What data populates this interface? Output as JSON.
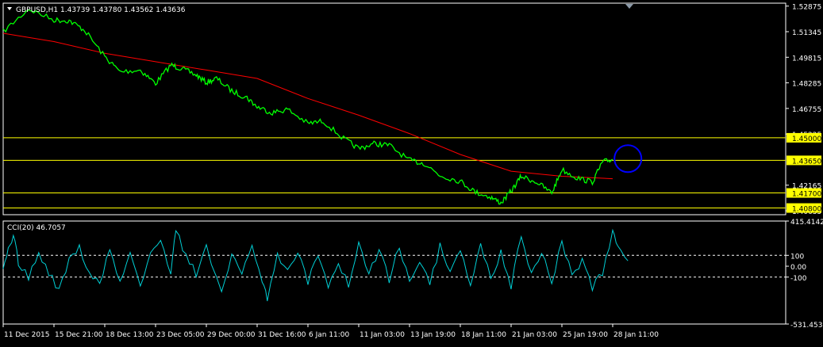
{
  "chart_data": [
    {
      "type": "line",
      "title": "GBPUSD,H1  1.43739 1.43780 1.43562 1.43636",
      "symbol": "GBPUSD,H1",
      "ohlc": [
        "1.43739",
        "1.43780",
        "1.43562",
        "1.43636"
      ],
      "colors": {
        "price": "#00ff00",
        "ma": "#ff0000",
        "levels": "#ffff00",
        "marker": "#0000ff",
        "background": "#000000",
        "frame": "#ffffff"
      },
      "ylim": [
        1.404,
        1.5305
      ],
      "y_ticks": [
        {
          "value": 1.52875,
          "label": "1.52875"
        },
        {
          "value": 1.51345,
          "label": "1.51345"
        },
        {
          "value": 1.49815,
          "label": "1.49815"
        },
        {
          "value": 1.48285,
          "label": "1.48285"
        },
        {
          "value": 1.46755,
          "label": "1.46755"
        },
        {
          "value": 1.45225,
          "label": "1.45225"
        },
        {
          "value": 1.42165,
          "label": "1.42165"
        },
        {
          "value": 1.40635,
          "label": "1.40635"
        }
      ],
      "levels": [
        {
          "value": 1.45,
          "label": "1.45000"
        },
        {
          "value": 1.4365,
          "label": "1.43650"
        },
        {
          "value": 1.417,
          "label": "1.41700"
        },
        {
          "value": 1.408,
          "label": "1.40800"
        }
      ],
      "x_labels": [
        "11 Dec 2015",
        "15 Dec 21:00",
        "18 Dec 13:00",
        "23 Dec 05:00",
        "29 Dec 00:00",
        "31 Dec 16:00",
        "6 Jan 11:00",
        "11 Jan 03:00",
        "13 Jan 19:00",
        "18 Jan 11:00",
        "21 Jan 03:00",
        "25 Jan 19:00",
        "28 Jan 11:00"
      ],
      "series": [
        {
          "x": [
            0,
            0.5,
            1,
            1.3,
            1.6,
            2,
            2.3,
            2.7,
            3,
            3.3,
            3.5,
            3.8,
            4,
            4.2,
            4.5,
            4.8,
            5,
            5.3,
            5.6,
            6,
            6.3,
            6.7,
            7,
            7.3,
            7.6,
            8,
            8.3,
            8.6,
            9,
            9.3,
            9.6,
            9.8,
            10,
            10.2,
            10.5,
            10.8,
            11,
            11.3,
            11.6,
            11.8,
            12
          ],
          "values": [
            1.5135,
            1.527,
            1.5205,
            1.52,
            1.5145,
            1.4985,
            1.4895,
            1.4905,
            1.4825,
            1.4935,
            1.4915,
            1.4875,
            1.483,
            1.4855,
            1.478,
            1.474,
            1.4685,
            1.465,
            1.467,
            1.4585,
            1.46,
            1.4495,
            1.4435,
            1.4465,
            1.4455,
            1.4365,
            1.4345,
            1.4275,
            1.424,
            1.4175,
            1.4145,
            1.411,
            1.418,
            1.427,
            1.4235,
            1.417,
            1.431,
            1.426,
            1.4235,
            1.4355,
            1.437
          ]
        },
        {
          "x": [
            0,
            1,
            2,
            3,
            4,
            5,
            6,
            7,
            8,
            9,
            10,
            11,
            12
          ],
          "values": [
            1.5125,
            1.5075,
            1.5005,
            1.4955,
            1.4905,
            1.4855,
            1.4735,
            1.4635,
            1.4525,
            1.44,
            1.43,
            1.427,
            1.4255
          ]
        }
      ],
      "marker": {
        "x": 12.3,
        "value": 1.4375
      }
    },
    {
      "type": "line",
      "title": "CCI(20) 46.7057",
      "ylim": [
        -531.4533,
        415.4142
      ],
      "y_ticks": [
        {
          "value": 415.4142,
          "label": "415.4142"
        },
        {
          "value": 100,
          "label": "100"
        },
        {
          "value": 0,
          "label": "0.00"
        },
        {
          "value": -100,
          "label": "-100"
        },
        {
          "value": -531.4533,
          "label": "-531.4533"
        }
      ],
      "levels": [
        100,
        -100
      ],
      "colors": {
        "line": "#00cfd5",
        "levels": "#ffffff"
      },
      "series": [
        {
          "x": [
            0,
            0.1,
            0.2,
            0.3,
            0.5,
            0.7,
            0.9,
            1.1,
            1.3,
            1.5,
            1.7,
            1.9,
            2.1,
            2.3,
            2.5,
            2.7,
            2.9,
            3.1,
            3.3,
            3.4,
            3.6,
            3.8,
            4,
            4.3,
            4.5,
            4.7,
            4.9,
            5.1,
            5.2,
            5.4,
            5.6,
            5.8,
            6,
            6.2,
            6.4,
            6.6,
            6.8,
            7,
            7.2,
            7.4,
            7.6,
            7.8,
            8,
            8.2,
            8.4,
            8.6,
            8.8,
            9,
            9.2,
            9.4,
            9.6,
            9.8,
            10,
            10.2,
            10.4,
            10.6,
            10.8,
            11,
            11.2,
            11.4,
            11.6,
            11.8,
            12,
            12.1,
            12.3
          ],
          "values": [
            -60,
            150,
            280,
            40,
            -110,
            120,
            -60,
            -220,
            60,
            180,
            -80,
            -160,
            160,
            -150,
            120,
            -200,
            120,
            260,
            -100,
            350,
            80,
            -70,
            180,
            -250,
            120,
            -80,
            200,
            -120,
            -290,
            120,
            -50,
            150,
            -150,
            120,
            -170,
            40,
            -190,
            200,
            -80,
            160,
            -130,
            190,
            -170,
            60,
            -160,
            180,
            -70,
            150,
            -180,
            210,
            -120,
            130,
            -180,
            300,
            -90,
            150,
            -170,
            230,
            -100,
            50,
            -200,
            -60,
            300,
            200,
            50
          ]
        }
      ]
    }
  ]
}
